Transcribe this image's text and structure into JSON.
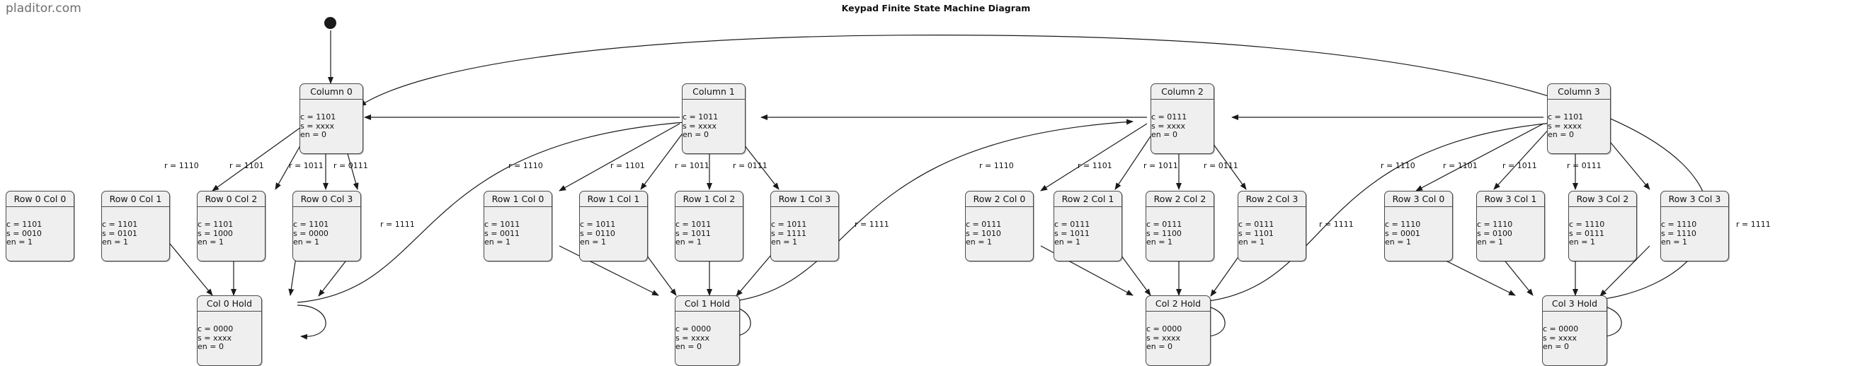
{
  "watermark": "pladitor.com",
  "title": "Keypad Finite State Machine Diagram",
  "nodes": {
    "start": {
      "name": "start-node"
    },
    "column0": {
      "title": "Column 0",
      "c": "c = 1101",
      "s": "s = xxxx",
      "en": "en = 0"
    },
    "column1": {
      "title": "Column 1",
      "c": "c = 1011",
      "s": "s = xxxx",
      "en": "en = 0"
    },
    "column2": {
      "title": "Column 2",
      "c": "c = 0111",
      "s": "s = xxxx",
      "en": "en = 0"
    },
    "column3": {
      "title": "Column 3",
      "c": "c = 1101",
      "s": "s = xxxx",
      "en": "en = 0"
    },
    "r0c0": {
      "title": "Row 0 Col 0",
      "c": "c = 1101",
      "s": "s = 0010",
      "en": "en = 1"
    },
    "r0c1": {
      "title": "Row 0 Col 1",
      "c": "c = 1101",
      "s": "s = 0101",
      "en": "en = 1"
    },
    "r0c2": {
      "title": "Row 0 Col 2",
      "c": "c = 1101",
      "s": "s = 1000",
      "en": "en = 1"
    },
    "r0c3": {
      "title": "Row 0 Col 3",
      "c": "c = 1101",
      "s": "s = 0000",
      "en": "en = 1"
    },
    "r1c0": {
      "title": "Row 1 Col 0",
      "c": "c = 1011",
      "s": "s = 0011",
      "en": "en = 1"
    },
    "r1c1": {
      "title": "Row 1 Col 1",
      "c": "c = 1011",
      "s": "s = 0110",
      "en": "en = 1"
    },
    "r1c2": {
      "title": "Row 1 Col 2",
      "c": "c = 1011",
      "s": "s = 1011",
      "en": "en = 1"
    },
    "r1c3": {
      "title": "Row 1 Col 3",
      "c": "c = 1011",
      "s": "s = 1111",
      "en": "en = 1"
    },
    "r2c0": {
      "title": "Row 2 Col 0",
      "c": "c = 0111",
      "s": "s = 1010",
      "en": "en = 1"
    },
    "r2c1": {
      "title": "Row 2 Col 1",
      "c": "c = 0111",
      "s": "s = 1011",
      "en": "en = 1"
    },
    "r2c2": {
      "title": "Row 2 Col 2",
      "c": "c = 0111",
      "s": "s = 1100",
      "en": "en = 1"
    },
    "r2c3": {
      "title": "Row 2 Col 3",
      "c": "c = 0111",
      "s": "s = 1101",
      "en": "en = 1"
    },
    "r3c0": {
      "title": "Row 3 Col 0",
      "c": "c = 1110",
      "s": "s = 0001",
      "en": "en = 1"
    },
    "r3c1": {
      "title": "Row 3 Col 1",
      "c": "c = 1110",
      "s": "s = 0100",
      "en": "en = 1"
    },
    "r3c2": {
      "title": "Row 3 Col 2",
      "c": "c = 1110",
      "s": "s = 0111",
      "en": "en = 1"
    },
    "r3c3": {
      "title": "Row 3 Col 3",
      "c": "c = 1110",
      "s": "s = 1110",
      "en": "en = 1"
    },
    "hold0": {
      "title": "Col 0 Hold",
      "c": "c = 0000",
      "s": "s = xxxx",
      "en": "en = 0"
    },
    "hold1": {
      "title": "Col 1 Hold",
      "c": "c = 0000",
      "s": "s = xxxx",
      "en": "en = 0"
    },
    "hold2": {
      "title": "Col 2 Hold",
      "c": "c = 0000",
      "s": "s = xxxx",
      "en": "en = 0"
    },
    "hold3": {
      "title": "Col 3 Hold",
      "c": "c = 0000",
      "s": "s = xxxx",
      "en": "en = 0"
    }
  },
  "labels": {
    "g0": {
      "l0": "r = 1110",
      "l1": "r = 1101",
      "l2": "r = 1011",
      "l3": "r = 0111",
      "l4": "r = 1111"
    },
    "g1": {
      "l0": "r = 1110",
      "l1": "r = 1101",
      "l2": "r = 1011",
      "l3": "r = 0111",
      "l4": "r = 1111"
    },
    "g2": {
      "l0": "r = 1110",
      "l1": "r = 1101",
      "l2": "r = 1011",
      "l3": "r = 0111",
      "l4": "r = 1111"
    },
    "g3": {
      "l0": "r = 1110",
      "l1": "r = 1101",
      "l2": "r = 1011",
      "l3": "r = 0111",
      "l4": "r = 1111"
    }
  },
  "colors": {
    "node_fill": "#efefef",
    "node_stroke": "#4a4a4a",
    "edge_stroke": "#1a1a1a",
    "text": "#111111",
    "watermark": "#6d6d6d"
  }
}
